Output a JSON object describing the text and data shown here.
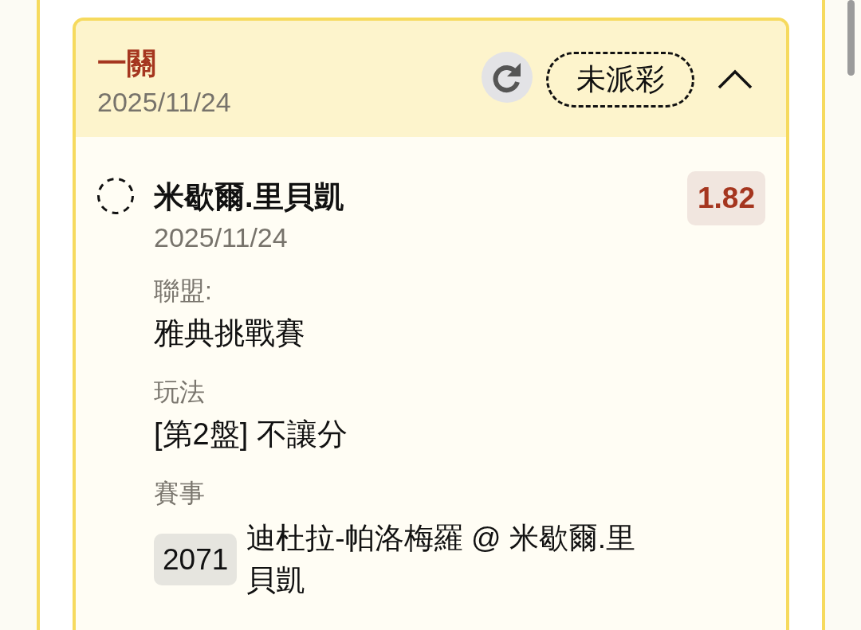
{
  "header": {
    "title": "一關",
    "date": "2025/11/24",
    "status": {
      "label": "未派彩",
      "settled": false
    },
    "expanded": true
  },
  "selection": {
    "settled": false,
    "name": "米歇爾.里貝凱",
    "odds": "1.82",
    "date": "2025/11/24"
  },
  "details": [
    {
      "kind": "text",
      "label": "聯盟:",
      "value": "雅典挑戰賽"
    },
    {
      "kind": "text",
      "label": "玩法",
      "value": "[第2盤] 不讓分"
    },
    {
      "kind": "match",
      "label": "賽事",
      "match_id": "2071",
      "value": "迪杜拉-帕洛梅羅 @ 米歇爾.里貝凱"
    }
  ]
}
